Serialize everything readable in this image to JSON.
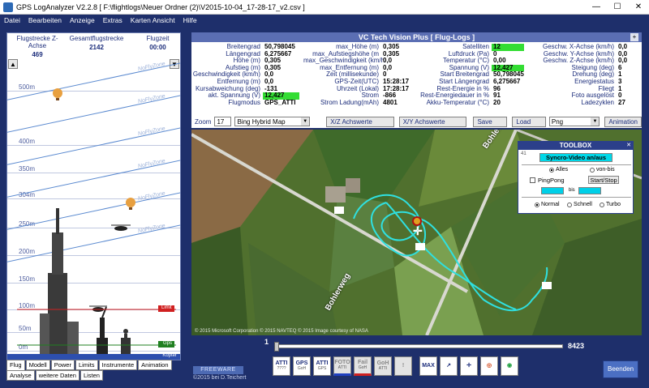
{
  "window": {
    "title": "GPS LogAnalyzer V2.2.8   [ F:\\flightlogs\\Neuer Ordner (2)\\V2015-10-04_17-28-17_v2.csv ]",
    "minimize": "—",
    "maximize": "☐",
    "close": "✕"
  },
  "menu": [
    "Datei",
    "Bearbeiten",
    "Anzeige",
    "Extras",
    "Karten Ansicht",
    "Hilfe"
  ],
  "left_panel": {
    "headers": [
      {
        "label": "Flugstrecke Z-Achse",
        "value": "469"
      },
      {
        "label": "Gesamtflugstrecke",
        "value": "2142"
      },
      {
        "label": "Flugzeit",
        "value": "00:00"
      }
    ],
    "side_buttons": [
      "▲",
      "▼"
    ],
    "scale_labels": [
      "500m",
      "400m",
      "350m",
      "304m",
      "250m",
      "200m",
      "150m",
      "100m",
      "50m",
      "0m"
    ],
    "diagonal_labels": [
      "NoFlyZone",
      "NoFlyZone",
      "NoFlyZone",
      "NoFlyZone",
      "NoFlyZone",
      "NoFlyZone"
    ],
    "limit_label": "Limit",
    "gps_label": "Gps",
    "footer": "Kopter"
  },
  "tabs": {
    "row1": [
      "Flug",
      "Modell",
      "Power",
      "Limits",
      "Instrumente",
      "Animation"
    ],
    "row2": [
      "Analyse",
      "weitere Daten",
      "Listen"
    ]
  },
  "vc_title": "VC Tech Vision Plus [ Flug-Logs ]",
  "vc_plus": "+",
  "telemetry": {
    "col1": [
      {
        "label": "Breitengrad",
        "value": "50,798045"
      },
      {
        "label": "Längengrad",
        "value": "6,275667"
      },
      {
        "label": "Höhe (m)",
        "value": "0,305"
      },
      {
        "label": "Aufstieg (m)",
        "value": "0,305"
      },
      {
        "label": "Geschwindigkeit (km/h)",
        "value": "0,0"
      },
      {
        "label": "Entfernung (m)",
        "value": "0,0"
      },
      {
        "label": "Kursabweichung (deg)",
        "value": "-131"
      },
      {
        "label": "akt. Spannung (V)",
        "value": "12,427",
        "highlight": true
      },
      {
        "label": "Flugmodus",
        "value": "GPS_ATTI"
      }
    ],
    "col2": [
      {
        "label": "max_Höhe (m)",
        "value": "0,305"
      },
      {
        "label": "max_Aufstiegshöhe (m",
        "value": "0,305"
      },
      {
        "label": "max_Geschwindigkeit (km/h",
        "value": "0,0"
      },
      {
        "label": "max_Entfernung (m)",
        "value": "0,0"
      },
      {
        "label": "Zeit (millisekunde)",
        "value": "0"
      },
      {
        "label": "GPS-Zeit(UTC)",
        "value": "15:28:17"
      },
      {
        "label": "Uhrzeit (Lokal)",
        "value": "17:28:17"
      },
      {
        "label": "Strom",
        "value": "-866"
      },
      {
        "label": "Strom Ladung(mAh)",
        "value": "4801"
      }
    ],
    "col3": [
      {
        "label": "Satelliten",
        "value": "12",
        "highlight": true
      },
      {
        "label": "Luftdruck (Pa)",
        "value": "0"
      },
      {
        "label": "Temperatur (°C)",
        "value": "0,00"
      },
      {
        "label": "Spannung (V)",
        "value": "12,427",
        "highlight": true
      },
      {
        "label": "Start Breitengrad",
        "value": "50,798045"
      },
      {
        "label": "Start Längengrad",
        "value": "6,275667"
      },
      {
        "label": "Rest-Energie in %",
        "value": "96"
      },
      {
        "label": "Rest-Energiedauer in %",
        "value": "91"
      },
      {
        "label": "Akku-Temperatur (°C)",
        "value": "20"
      }
    ],
    "col4": [
      {
        "label": "Geschw. X-Achse (km/h)",
        "value": "0,0"
      },
      {
        "label": "Geschw. Y-Achse (km/h)",
        "value": "0,0"
      },
      {
        "label": "Geschw. Z-Achse (km/h)",
        "value": "0,0"
      },
      {
        "label": "Steigung (deg)",
        "value": "6"
      },
      {
        "label": "Drehung (deg)",
        "value": "1"
      },
      {
        "label": "Energiestatus",
        "value": "3"
      },
      {
        "label": "Fliegt",
        "value": "1"
      },
      {
        "label": "Foto ausgelöst",
        "value": "0"
      },
      {
        "label": "Ladezyklen",
        "value": "27"
      }
    ]
  },
  "toolbar": {
    "zoom_label": "Zoom",
    "zoom_value": "17",
    "map_type": "Bing Hybrid Map",
    "btn_x": "X/Z Achswerte an/aus",
    "btn_y": "X/Y Achswerte an/aus",
    "btn_save": "Save Bild",
    "btn_load": "Load Bild",
    "format": "Png",
    "btn_anim": "Animation"
  },
  "map": {
    "road_label_1": "Bohler",
    "road_label_2": "Bohlerweg",
    "credit": "© 2015 Microsoft Corporation  © 2015 NAVTEQ  © 2015 Image courtesy of NASA"
  },
  "toolbox": {
    "title": "TOOLBOX",
    "close": "✕",
    "num": "41",
    "sync_btn": "Syncro-Video an/aus",
    "radio_alles": "Alles",
    "radio_vonbis": "von-bis",
    "pingpong": "PingPong",
    "startstop": "Start/Stop",
    "bis": "bis",
    "speed_normal": "Normal",
    "speed_schnell": "Schnell",
    "speed_turbo": "Turbo"
  },
  "slider": {
    "min": "1",
    "max": "8423",
    "position": 0
  },
  "footer": {
    "freeware": "FREEWARE",
    "copyright": "©2015  bei D.Teichert",
    "exit": "Beenden"
  },
  "icon_buttons": [
    {
      "name": "atti-btn",
      "big": "ATTI",
      "small": "????"
    },
    {
      "name": "gps-btn",
      "big": "GPS",
      "small": "GoH"
    },
    {
      "name": "gps-atti-btn",
      "big": "ATTI",
      "small": "GPS"
    },
    {
      "name": "foto-btn",
      "big": "FOTO",
      "small": "ATTI"
    },
    {
      "name": "fail-btn",
      "big": "Fail",
      "small": "GoH"
    },
    {
      "name": "goh-btn",
      "big": "GoH",
      "small": "ATTI"
    },
    {
      "name": "warn-btn",
      "big": "!",
      "small": ""
    },
    {
      "name": "max-btn",
      "big": "MAX",
      "small": ""
    },
    {
      "name": "chart-btn",
      "big": "↗",
      "small": ""
    },
    {
      "name": "compass-btn",
      "big": "✛",
      "small": ""
    },
    {
      "name": "target-btn",
      "big": "◎",
      "small": ""
    },
    {
      "name": "radar-btn",
      "big": "◉",
      "small": ""
    }
  ]
}
